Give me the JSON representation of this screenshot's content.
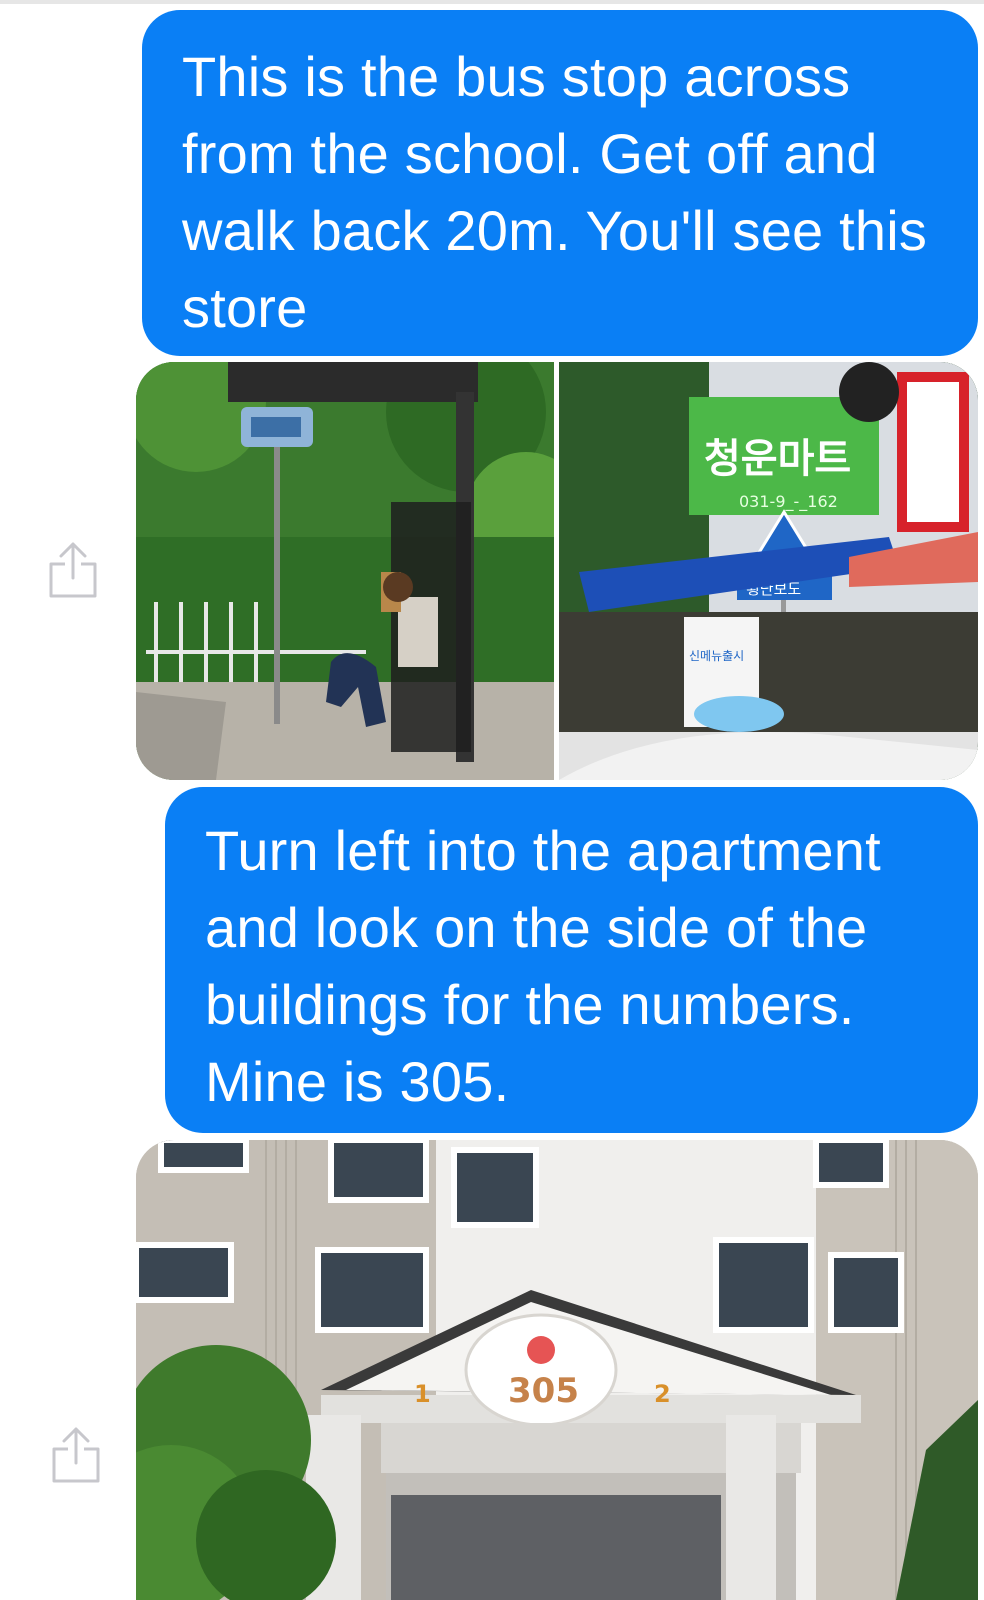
{
  "messages": [
    {
      "text": "This is the bus stop across from the school. Get off and walk back 20m. You'll see this store"
    },
    {
      "text": "Turn left into the apartment and look on the side of the buildings for the numbers. Mine is 305."
    }
  ],
  "photos": {
    "store": {
      "sign": "청운마트",
      "crosswalk_sign": "횡단보도",
      "poster": "신메뉴출시",
      "phone": "031-9_-_162"
    },
    "building": {
      "number": "305",
      "left_label": "1",
      "right_label": "2"
    }
  },
  "colors": {
    "bubble": "#0a7ff5",
    "share_icon": "#c7c7cc"
  },
  "icons": [
    "share-icon",
    "share-icon"
  ]
}
